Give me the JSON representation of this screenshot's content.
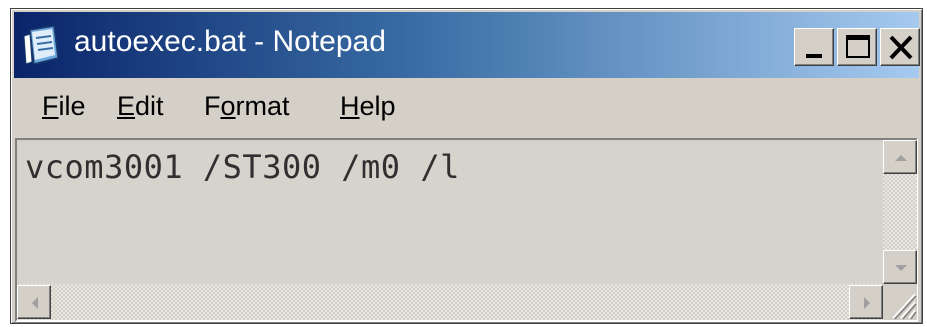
{
  "window": {
    "title": "autoexec.bat - Notepad",
    "app_icon": "notepad-icon",
    "controls": {
      "minimize_icon": "minimize-icon",
      "maximize_icon": "maximize-icon",
      "close_icon": "close-icon"
    }
  },
  "menu": {
    "items": [
      {
        "label_ul": "F",
        "label_rest": "ile"
      },
      {
        "label_ul": "E",
        "label_rest": "dit"
      },
      {
        "label_pre": "F",
        "label_ul": "o",
        "label_rest": "rmat"
      },
      {
        "label_ul": "H",
        "label_rest": "elp"
      }
    ]
  },
  "editor": {
    "content": "vcom3001 /ST300 /m0 /l"
  },
  "colors": {
    "title_start": "#0a246a",
    "title_end": "#a6caf0",
    "face": "#d4d0c8"
  }
}
